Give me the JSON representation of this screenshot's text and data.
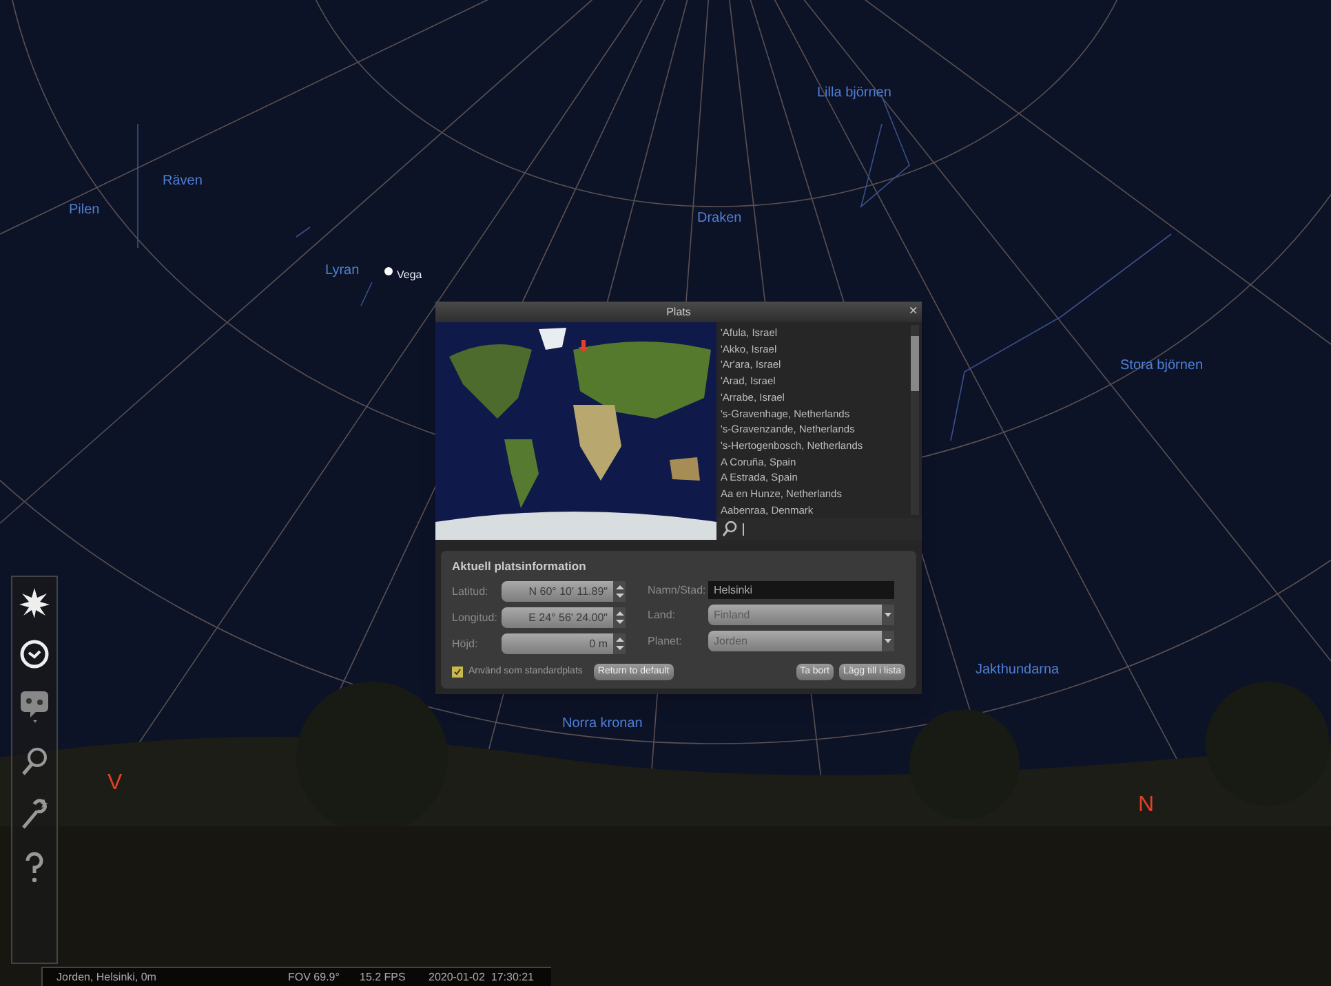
{
  "sky": {
    "labels": [
      {
        "kind": "constellation",
        "text": "Lilla björnen"
      },
      {
        "kind": "constellation",
        "text": "Räven"
      },
      {
        "kind": "constellation",
        "text": "Pilen"
      },
      {
        "kind": "constellation",
        "text": "Draken"
      },
      {
        "kind": "constellation",
        "text": "Lyran"
      },
      {
        "kind": "star",
        "text": "Vega"
      },
      {
        "kind": "constellation",
        "text": "Stora björnen"
      },
      {
        "kind": "constellation",
        "text": "Jakthundarna"
      },
      {
        "kind": "constellation",
        "text": "Norra kronan"
      },
      {
        "kind": "cardinal",
        "text": "V"
      },
      {
        "kind": "cardinal",
        "text": "N"
      }
    ]
  },
  "dialog": {
    "title": "Plats",
    "close": "×",
    "locations": [
      "'Afula, Israel",
      "'Akko, Israel",
      "'Ar'ara, Israel",
      "'Arad, Israel",
      "'Arrabe, Israel",
      "'s-Gravenhage, Netherlands",
      "'s-Gravenzande, Netherlands",
      "'s-Hertogenbosch, Netherlands",
      "A Coruña, Spain",
      "A Estrada, Spain",
      "Aa en Hunze, Netherlands",
      "Aabenraa, Denmark"
    ],
    "info": {
      "heading": "Aktuell platsinformation",
      "latitude": {
        "label": "Latitud:",
        "value": "N 60° 10' 11.89\""
      },
      "longitude": {
        "label": "Longitud:",
        "value": "E 24° 56' 24.00\""
      },
      "altitude": {
        "label": "Höjd:",
        "value": "0 m"
      },
      "name": {
        "label": "Namn/Stad:",
        "value": "Helsinki"
      },
      "country": {
        "label": "Land:",
        "value": "Finland"
      },
      "planet": {
        "label": "Planet:",
        "value": "Jorden"
      },
      "default_checkbox": {
        "label": "Använd som standardplats",
        "checked": true
      },
      "buttons": [
        "Return to default",
        "Ta bort",
        "Lägg till i lista"
      ]
    }
  },
  "status_bar": {
    "location": "Jorden, Helsinki, 0m",
    "fov": "FOV 69.9°",
    "fps": "15.2 FPS",
    "datetime": "2020-01-02  17:30:21"
  }
}
